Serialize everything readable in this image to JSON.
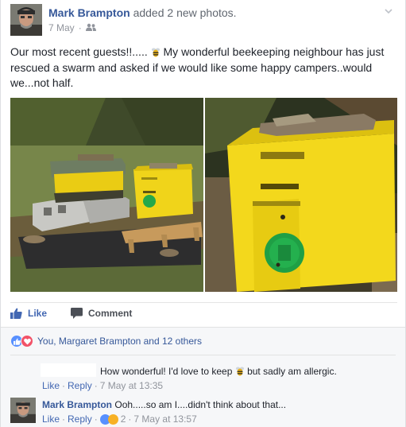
{
  "post": {
    "author": "Mark Brampton",
    "action": "added 2 new photos.",
    "date": "7 May",
    "meta_separator": "·",
    "text_before_emoji": "Our most recent guests!!.....",
    "text_after_emoji": "My wonderful beekeeping neighbour has just rescued a swarm and asked if we would like some happy campers..would we...not half."
  },
  "actions": {
    "like": "Like",
    "comment": "Comment"
  },
  "reactions": {
    "summary": "You, Margaret Brampton and 12 others"
  },
  "comments": [
    {
      "author": "",
      "text_before_emoji": "How wonderful! I'd love to keep",
      "text_after_emoji": "but sadly am allergic.",
      "like": "Like",
      "reply": "Reply",
      "time": "7 May at 13:35"
    },
    {
      "author": "Mark Brampton",
      "text": "Ooh.....so am I....didn't think about that...",
      "like": "Like",
      "reply": "Reply",
      "reaction_count": "2",
      "time": "7 May at 13:57"
    }
  ],
  "colors": {
    "link": "#365899",
    "like_blue": "#4267b2",
    "secondary_text": "#90949c",
    "hive_yellow": "#f2d20a",
    "comment_bg": "#f6f7f9"
  },
  "icons": [
    "chevron-down-icon",
    "friends-audience-icon",
    "bee-emoji-icon",
    "thumbs-up-icon",
    "comment-icon",
    "like-reaction-icon",
    "love-reaction-icon",
    "haha-reaction-icon"
  ]
}
